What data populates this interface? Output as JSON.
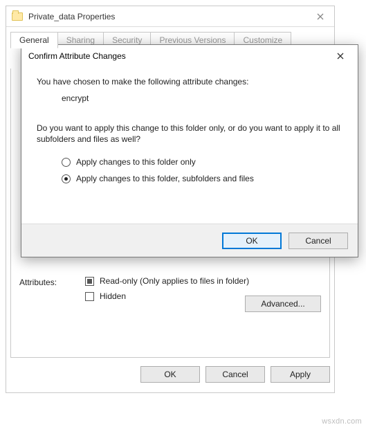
{
  "properties_window": {
    "title": "Private_data Properties",
    "tabs": {
      "general": "General",
      "t1": "Sharing",
      "t2": "Security",
      "t3": "Previous Versions",
      "t4": "Customize"
    },
    "attributes": {
      "label": "Attributes:",
      "readonly": "Read-only (Only applies to files in folder)",
      "hidden": "Hidden",
      "advanced": "Advanced..."
    },
    "buttons": {
      "ok": "OK",
      "cancel": "Cancel",
      "apply": "Apply"
    }
  },
  "confirm_dialog": {
    "title": "Confirm Attribute Changes",
    "line1": "You have chosen to make the following attribute changes:",
    "change": "encrypt",
    "line2": "Do you want to apply this change to this folder only, or do you want to apply it to all subfolders and files as well?",
    "option_folder_only": "Apply changes to this folder only",
    "option_recursive": "Apply changes to this folder, subfolders and files",
    "selected": "recursive",
    "buttons": {
      "ok": "OK",
      "cancel": "Cancel"
    }
  },
  "watermark": "wsxdn.com"
}
